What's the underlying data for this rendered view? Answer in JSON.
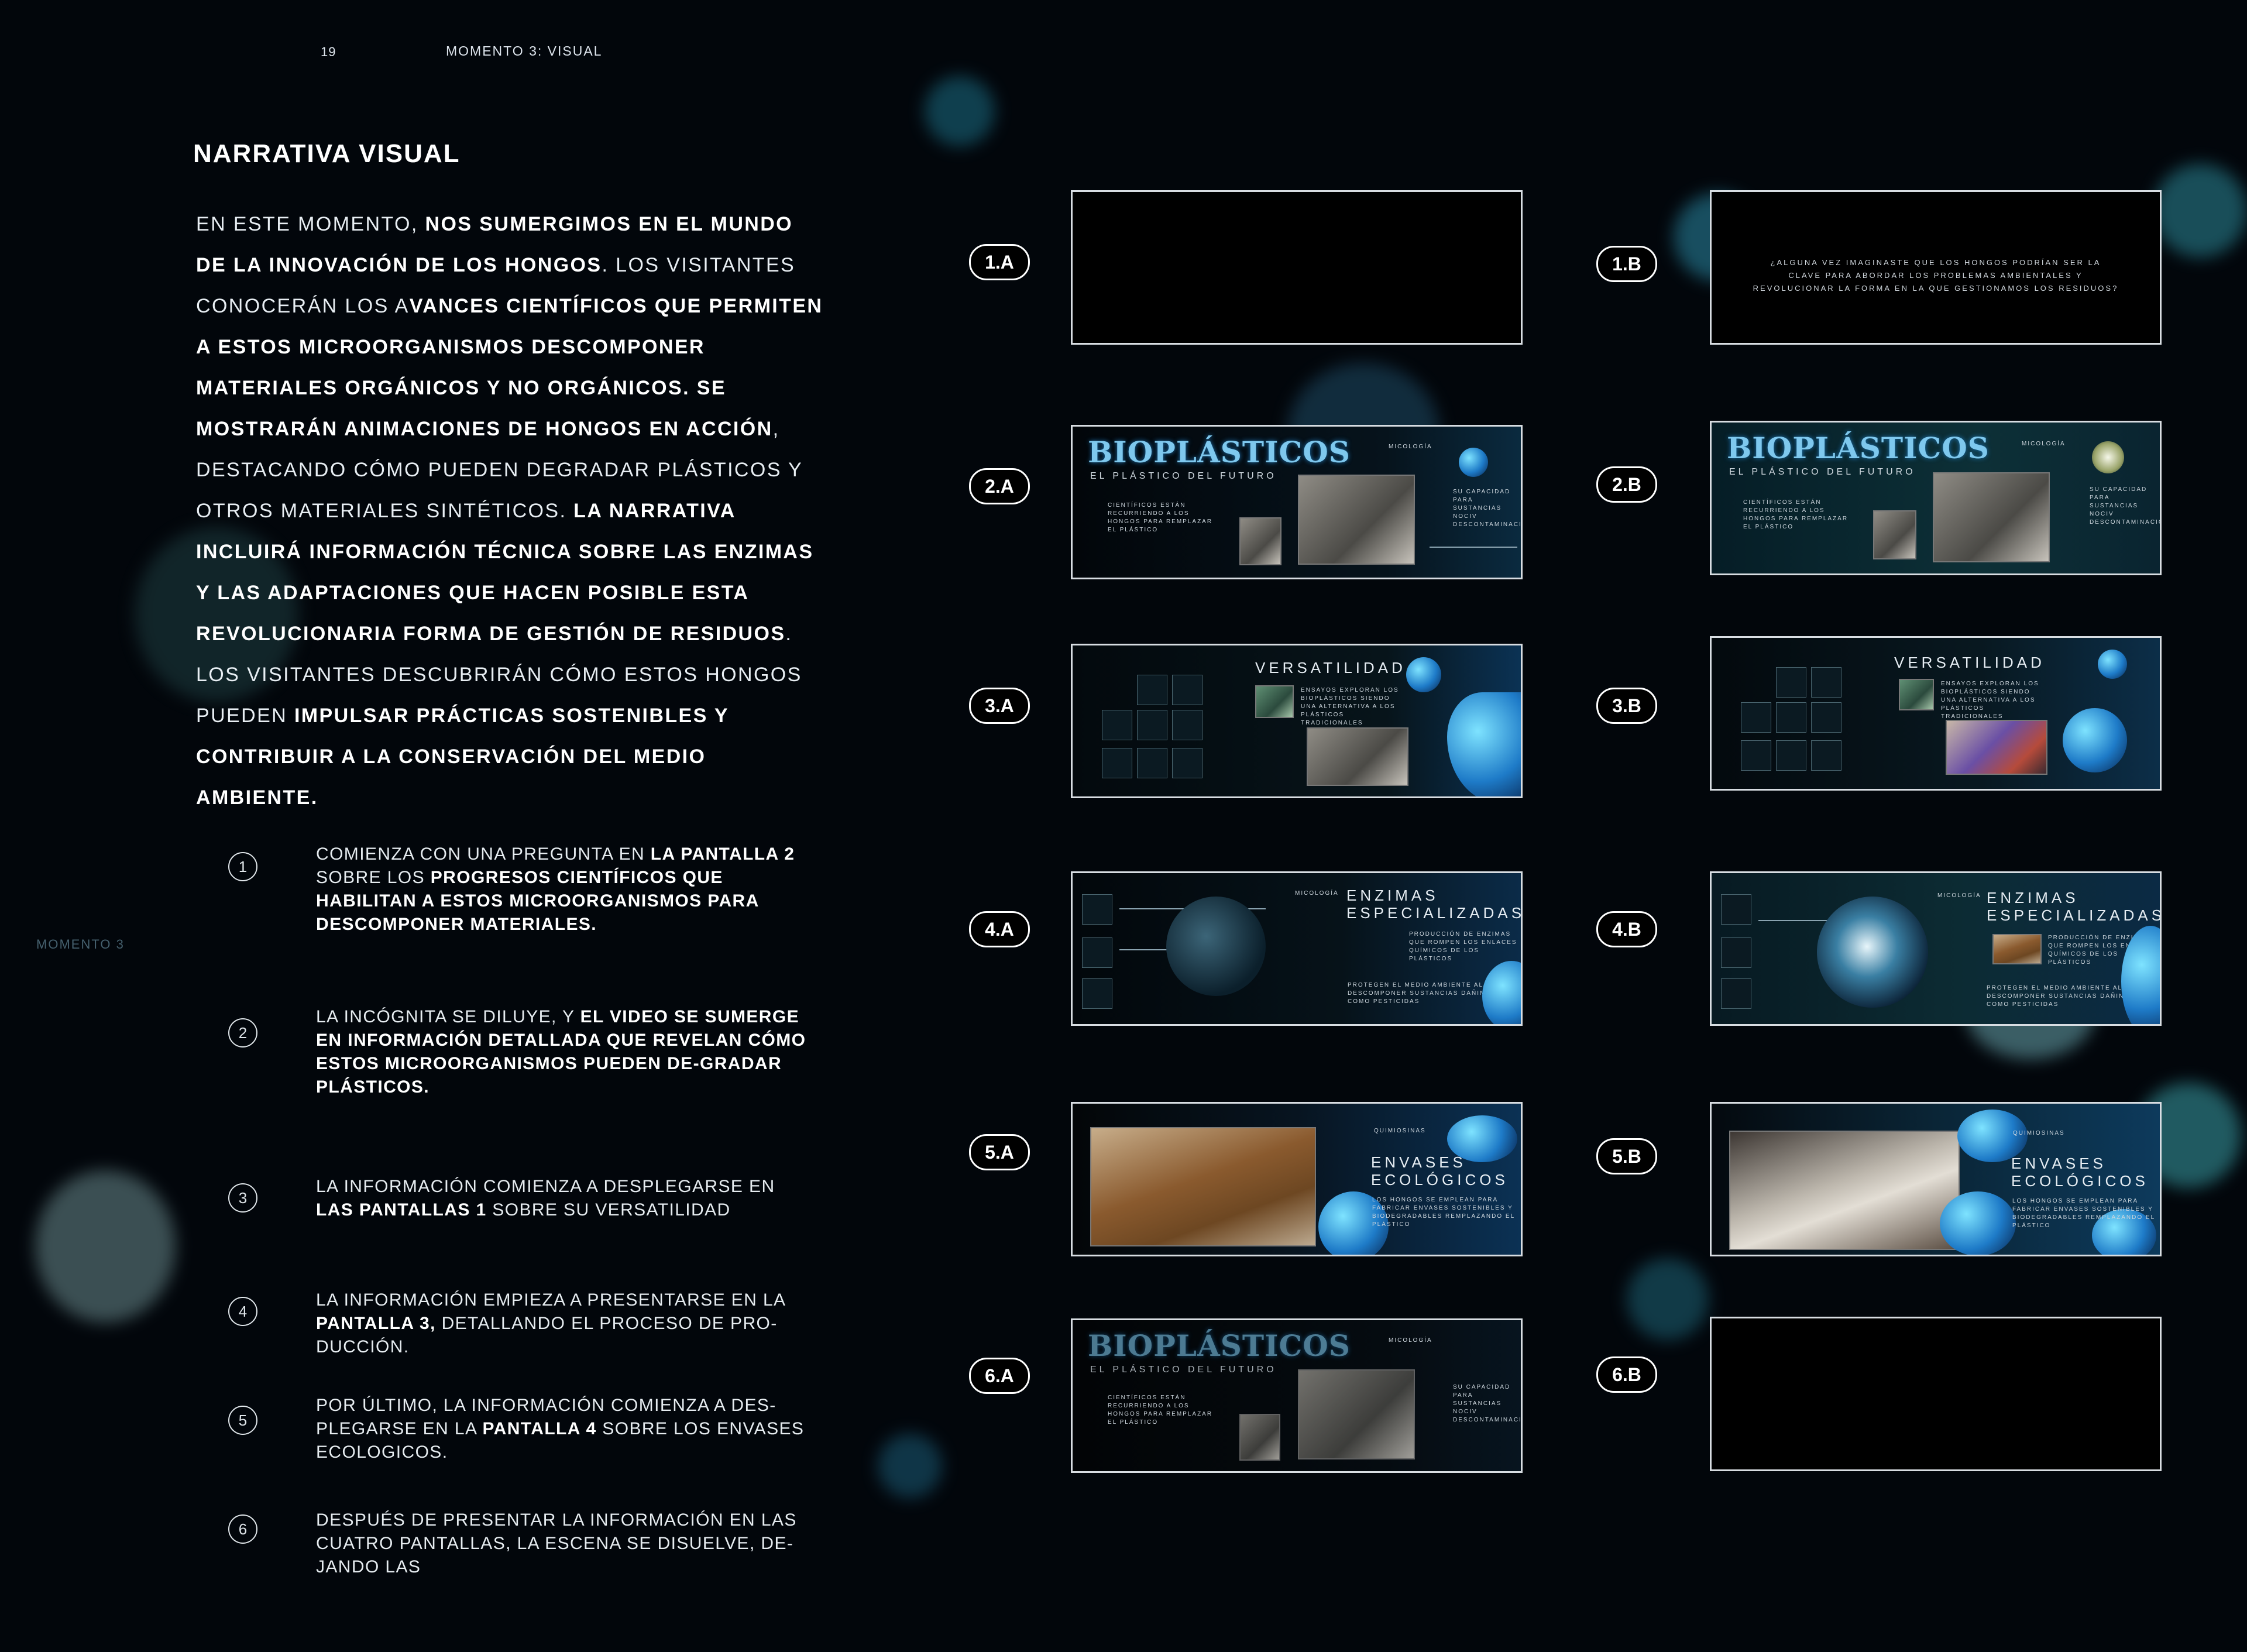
{
  "header": {
    "page_number": "19",
    "title": "MOMENTO 3: VISUAL",
    "side_label": "MOMENTO 3"
  },
  "section_title": "NARRATIVA VISUAL",
  "intro": [
    {
      "t": "EN ESTE MOMENTO, ",
      "b": false
    },
    {
      "t": "NOS SUMERGIMOS EN EL MUNDO DE LA INNOVACIÓN DE LOS HONGOS",
      "b": true
    },
    {
      "t": ". LOS VISITANTES CONOCERÁN LOS A",
      "b": false
    },
    {
      "t": "VANCES CIENTÍFICOS QUE PERMITEN A ESTOS MICROORGANISMOS DESCOMPONER MATERIALES ORGÁNICOS Y NO ORGÁNICOS. SE MOSTRARÁN ANIMACIONES DE HONGOS EN ACCIÓN",
      "b": true
    },
    {
      "t": ", DESTACANDO CÓMO PUEDEN DEGRADAR PLÁSTICOS Y OTROS MATERIALES SINTÉTICOS. ",
      "b": false
    },
    {
      "t": "LA NARRATIVA INCLUIRÁ INFORMACIÓN TÉCNICA SOBRE LAS ENZIMAS Y LAS ADAPTACIONES QUE HACEN POSIBLE ESTA REVOLUCIONARIA FORMA DE GESTIÓN DE RESIDUOS",
      "b": true
    },
    {
      "t": ". LOS VISITANTES DESCUBRIRÁN CÓMO ESTOS HONGOS PUEDEN ",
      "b": false
    },
    {
      "t": "IMPULSAR PRÁCTICAS SOSTENIBLES Y CONTRIBUIR A LA CONSERVACIÓN DEL MEDIO AMBIENTE.",
      "b": true
    }
  ],
  "steps": [
    {
      "num": "1",
      "parts": [
        {
          "t": "COMIENZA CON UNA PREGUNTA EN ",
          "b": false
        },
        {
          "t": "LA PANTALLA 2",
          "b": true
        },
        {
          "t": " SOBRE LOS ",
          "b": false
        },
        {
          "t": "PROGRESOS CIENTÍFICOS QUE HABILITAN A ESTOS MICROORGANISMOS PARA DESCOMPONER MATERIALES.",
          "b": true
        }
      ]
    },
    {
      "num": "2",
      "parts": [
        {
          "t": "LA INCÓGNITA SE DILUYE, Y ",
          "b": false
        },
        {
          "t": "EL VIDEO SE SUMERGE EN INFORMACIÓN DETALLADA QUE REVELAN CÓMO ESTOS MICROORGANISMOS PUEDEN DE-GRADAR PLÁSTICOS.",
          "b": true
        }
      ]
    },
    {
      "num": "3",
      "parts": [
        {
          "t": "LA INFORMACIÓN COMIENZA A DESPLEGARSE EN ",
          "b": false
        },
        {
          "t": "LAS PANTALLAS 1",
          "b": true
        },
        {
          "t": " SOBRE SU VERSATILIDAD",
          "b": false
        }
      ]
    },
    {
      "num": "4",
      "parts": [
        {
          "t": "LA INFORMACIÓN EMPIEZA A PRESENTARSE EN LA ",
          "b": false
        },
        {
          "t": "PANTALLA 3,",
          "b": true
        },
        {
          "t": " DETALLANDO EL PROCESO DE PRO-DUCCIÓN.",
          "b": false
        }
      ]
    },
    {
      "num": "5",
      "parts": [
        {
          "t": "POR ÚLTIMO, LA INFORMACIÓN COMIENZA A DES-PLEGARSE EN LA ",
          "b": false
        },
        {
          "t": "PANTALLA 4",
          "b": true
        },
        {
          "t": " SOBRE LOS ENVASES ECOLOGICOS.",
          "b": false
        }
      ]
    },
    {
      "num": "6",
      "parts": [
        {
          "t": "DESPUÉS DE PRESENTAR LA INFORMACIÓN EN LAS CUATRO PANTALLAS, LA ESCENA SE DISUELVE, DE-JANDO LAS",
          "b": false
        }
      ]
    }
  ],
  "frames": {
    "labels": [
      "1.A",
      "1.B",
      "2.A",
      "2.B",
      "3.A",
      "3.B",
      "4.A",
      "4.B",
      "5.A",
      "5.B",
      "6.A",
      "6.B"
    ],
    "question": "¿ALGUNA VEZ IMAGINASTE QUE LOS HONGOS PODRÍAN SER LA CLAVE PARA ABORDAR LOS PROBLEMAS AMBIENTALES Y REVOLUCIONAR LA FORMA EN LA QUE GESTIONAMOS LOS RESIDUOS?",
    "bio_title": "BIOPLÁSTICOS",
    "bio_sub": "EL PLÁSTICO DEL FUTURO",
    "bio_tag": "MICOLOGÍA",
    "bio_left": "CIENTÍFICOS ESTÁN RECURRIENDO A LOS HONGOS PARA REMPLAZAR EL PLÁSTICO",
    "bio_right": "SU CAPACIDAD PARA SUSTANCIAS NOCIV DESCONTAMINACIÓ",
    "vers_title": "VERSATILIDAD",
    "vers_text": "ENSAYOS EXPLORAN LOS BIOPLÁSTICOS SIENDO UNA ALTERNATIVA A LOS PLÁSTICOS TRADICIONALES",
    "enz_title_1": "ENZIMAS",
    "enz_title_2": "ESPECIALIZADAS",
    "enz_text": "PRODUCCIÓN DE ENZIMAS QUE ROMPEN LOS ENLACES QUÍMICOS DE LOS PLÁSTICOS",
    "enz_text2": "PROTEGEN EL MEDIO AMBIENTE AL DESCOMPONER SUSTANCIAS DAÑINAS COMO PESTICIDAS",
    "env_tag": "QUIMIOSINAS",
    "env_title_1": "ENVASES",
    "env_title_2": "ECOLÓGICOS",
    "env_text": "LOS HONGOS SE EMPLEAN PARA FABRICAR ENVASES SOSTENIBLES Y BIODEGRADABLES REMPLAZANDO EL PLÁSTICO"
  }
}
